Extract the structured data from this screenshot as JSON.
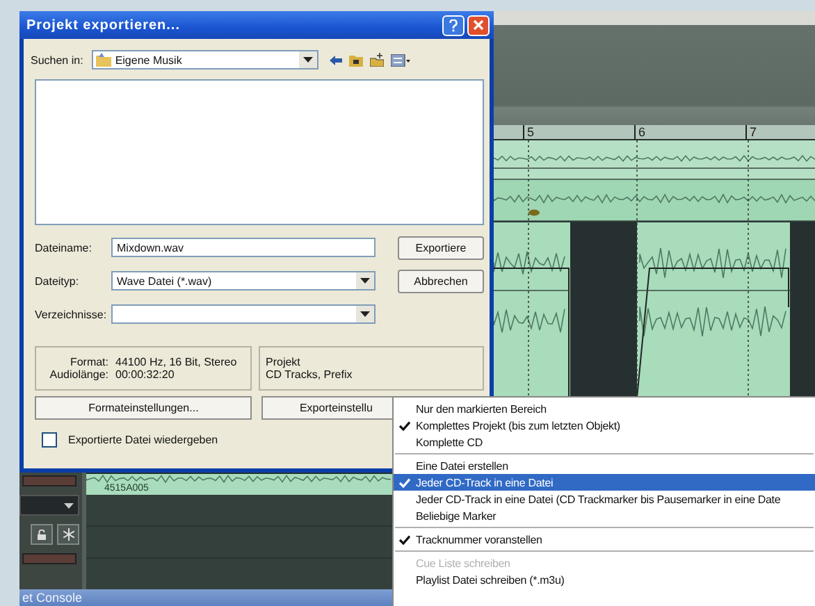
{
  "dialog": {
    "title": "Projekt exportieren...",
    "look_in": {
      "label": "Suchen in:",
      "value": "Eigene Musik"
    },
    "fields": [
      {
        "label": "Dateiname:",
        "value": "Mixdown.wav",
        "kind": "text"
      },
      {
        "label": "Dateityp:",
        "value": "Wave Datei (*.wav)",
        "kind": "select"
      },
      {
        "label": "Verzeichnisse:",
        "kind": "select"
      }
    ],
    "buttons": [
      "Exportiere",
      "Abbrechen"
    ],
    "info": {
      "format_label": "Format:",
      "format": "44100 Hz, 16 Bit, Stereo",
      "length_label": "Audiolänge:",
      "length": "00:00:32:20",
      "project": [
        "Projekt",
        "CD Tracks, Prefix"
      ]
    },
    "settings_buttons": [
      "Formateinstellungen...",
      "Exporteinstellu"
    ],
    "play_checkbox": {
      "label": "Exportierte Datei wiedergeben",
      "checked": false
    }
  },
  "daw": {
    "ruler": [
      "5",
      "6",
      "7"
    ],
    "clip_label": "4515A005",
    "console_title": "et Console"
  },
  "context_menu": {
    "sections": [
      {
        "items": [
          {
            "label": "Nur den markierten Bereich",
            "checked": false,
            "selected": false,
            "disabled": false
          },
          {
            "label": "Komplettes Projekt (bis zum letzten Objekt)",
            "checked": true,
            "selected": false,
            "disabled": false
          },
          {
            "label": "Komplette CD",
            "checked": false,
            "selected": false,
            "disabled": false
          }
        ]
      },
      {
        "items": [
          {
            "label": "Eine Datei erstellen",
            "checked": false,
            "selected": false,
            "disabled": false
          },
          {
            "label": "Jeder CD-Track in eine Datei",
            "checked": true,
            "selected": true,
            "disabled": false
          },
          {
            "label": "Jeder CD-Track in eine Datei (CD Trackmarker bis Pausemarker in eine Date",
            "checked": false,
            "selected": false,
            "disabled": false
          },
          {
            "label": "Beliebige Marker",
            "checked": false,
            "selected": false,
            "disabled": false
          }
        ]
      },
      {
        "items": [
          {
            "label": "Tracknummer voranstellen",
            "checked": true,
            "selected": false,
            "disabled": false
          }
        ]
      },
      {
        "items": [
          {
            "label": "Cue Liste schreiben",
            "checked": false,
            "selected": false,
            "disabled": true
          },
          {
            "label": "Playlist Datei schreiben (*.m3u)",
            "checked": false,
            "selected": false,
            "disabled": false
          }
        ]
      }
    ]
  }
}
